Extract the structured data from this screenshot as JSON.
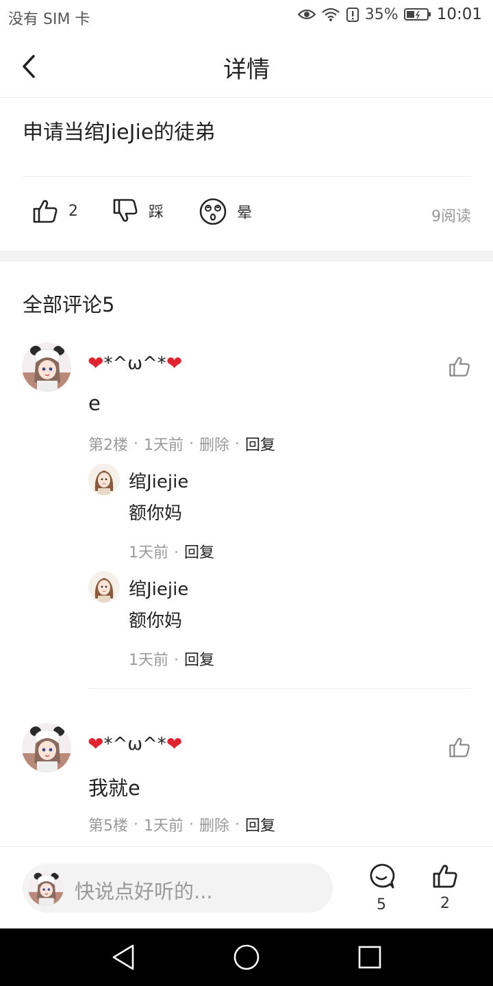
{
  "status_bar": {
    "carrier": "没有 SIM 卡",
    "battery": "35%",
    "time": "10:01"
  },
  "header": {
    "title": "详情"
  },
  "post": {
    "title": "申请当绾JieJie的徒弟",
    "like_count": "2",
    "dislike_label": "踩",
    "dizzy_label": "晕",
    "read_count": "9阅读"
  },
  "comments_section": {
    "heading": "全部评论5",
    "comments": [
      {
        "name": "*^ω^*",
        "text": "e",
        "floor": "第2楼",
        "time": "1天前",
        "delete": "删除",
        "reply": "回复",
        "replies": [
          {
            "name": "绾Jiejie",
            "text": "额你妈",
            "time": "1天前",
            "reply": "回复"
          },
          {
            "name": "绾Jiejie",
            "text": "额你妈",
            "time": "1天前",
            "reply": "回复"
          }
        ]
      },
      {
        "name": "*^ω^*",
        "text": "我就e",
        "floor": "第5楼",
        "time": "1天前",
        "delete": "删除",
        "reply": "回复"
      }
    ]
  },
  "bottom_bar": {
    "placeholder": "快说点好听的...",
    "comment_count": "5",
    "like_count": "2"
  },
  "colors": {
    "heart": "#e0232e",
    "muted": "#999999",
    "divider": "#eeeeee"
  },
  "icons": [
    "back-arrow-icon",
    "thumbs-up-icon",
    "thumbs-down-icon",
    "dizzy-face-icon",
    "comment-bubble-icon",
    "nav-back-icon",
    "nav-home-icon",
    "nav-recents-icon"
  ]
}
